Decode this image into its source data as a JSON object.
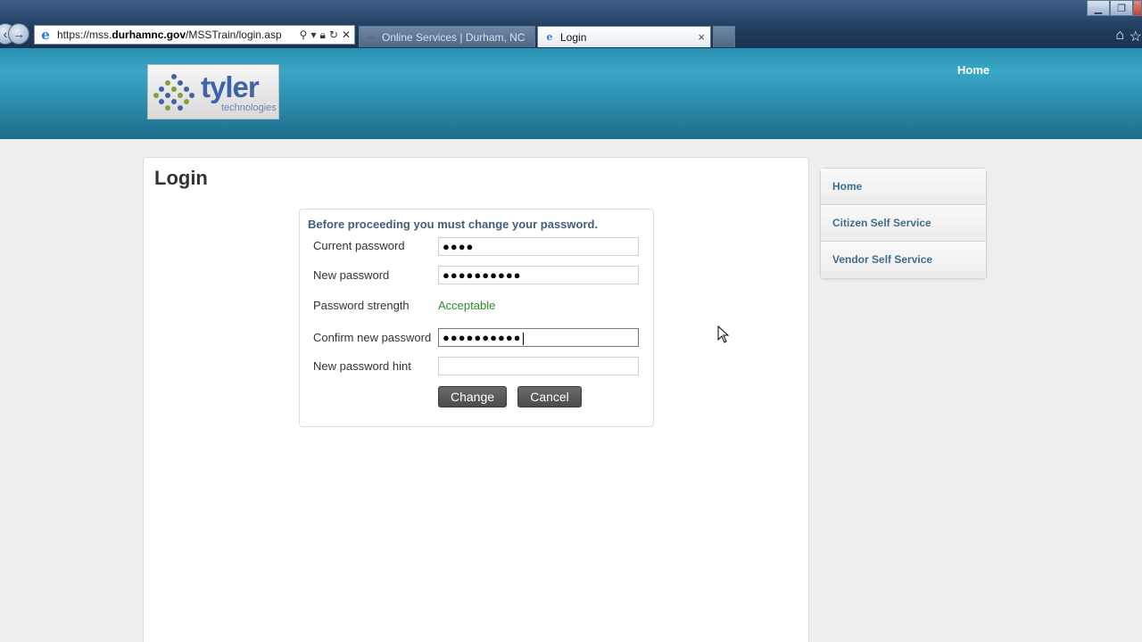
{
  "browser": {
    "url_prefix": "https://mss.",
    "url_domain": "durhamnc.gov",
    "url_path": "/MSSTrain/login.asp",
    "tabs": [
      {
        "title": "Online Services | Durham, NC"
      },
      {
        "title": "Login"
      }
    ],
    "tab_close": "×"
  },
  "header": {
    "logo_word": "tyler",
    "logo_sub": "technologies",
    "home_link": "Home"
  },
  "main": {
    "title": "Login",
    "message": "Before proceeding you must change your password.",
    "fields": {
      "current_password_label": "Current password",
      "current_password_value": "●●●●",
      "new_password_label": "New password",
      "new_password_value": "●●●●●●●●●●",
      "strength_label": "Password strength",
      "strength_value": "Acceptable",
      "confirm_label": "Confirm new password",
      "confirm_value": "●●●●●●●●●●",
      "hint_label": "New password hint",
      "hint_value": ""
    },
    "buttons": {
      "change": "Change",
      "cancel": "Cancel"
    }
  },
  "sidebar": {
    "items": [
      {
        "label": "Home"
      },
      {
        "label": "Citizen Self Service"
      },
      {
        "label": "Vendor Self Service"
      }
    ]
  },
  "colors": {
    "header_blue": "#2b8cab",
    "strength_green": "#2c8a2c",
    "link_blue": "#3f6d8c"
  }
}
